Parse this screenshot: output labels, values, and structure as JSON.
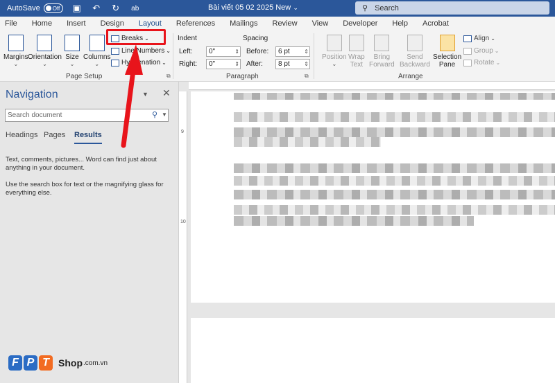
{
  "titlebar": {
    "autosave_label": "AutoSave",
    "autosave_state": "Off",
    "document_title": "Bài viết 05 02 2025 New",
    "title_caret": "⌄",
    "format_icon_text": "ab",
    "search_placeholder": "Search"
  },
  "tabs": [
    "File",
    "Home",
    "Insert",
    "Design",
    "Layout",
    "References",
    "Mailings",
    "Review",
    "View",
    "Developer",
    "Help",
    "Acrobat"
  ],
  "active_tab": "Layout",
  "page_setup": {
    "margins": "Margins",
    "orientation": "Orientation",
    "size": "Size",
    "columns": "Columns",
    "breaks": "Breaks",
    "line_numbers": "Line Numbers",
    "hyphenation": "Hyphenation",
    "group_label": "Page Setup"
  },
  "paragraph": {
    "indent_label": "Indent",
    "spacing_label": "Spacing",
    "left_label": "Left:",
    "right_label": "Right:",
    "before_label": "Before:",
    "after_label": "After:",
    "left_value": "0\"",
    "right_value": "0\"",
    "before_value": "6 pt",
    "after_value": "8 pt",
    "group_label": "Paragraph"
  },
  "arrange": {
    "position": "Position",
    "wrap_text_1": "Wrap",
    "wrap_text_2": "Text",
    "bring_forward_1": "Bring",
    "bring_forward_2": "Forward",
    "send_backward_1": "Send",
    "send_backward_2": "Backward",
    "selection_pane_1": "Selection",
    "selection_pane_2": "Pane",
    "align": "Align",
    "group": "Group",
    "rotate": "Rotate",
    "group_label": "Arrange"
  },
  "navigation": {
    "title": "Navigation",
    "search_placeholder": "Search document",
    "tabs": [
      "Headings",
      "Pages",
      "Results"
    ],
    "active_tab": "Results",
    "message_1": "Text, comments, pictures... Word can find just about anything in your document.",
    "message_2": "Use the search box for text or the magnifying glass for everything else."
  },
  "ruler_left_numbers": [
    "9",
    "10"
  ],
  "logo": {
    "letters": [
      "F",
      "P",
      "T"
    ],
    "shop": "Shop",
    "domain": ".com.vn"
  },
  "colors": {
    "word_blue": "#2b579a",
    "highlight_red": "#e8141b",
    "fpt_blue": "#2b6cc4",
    "fpt_orange": "#f26b21"
  }
}
